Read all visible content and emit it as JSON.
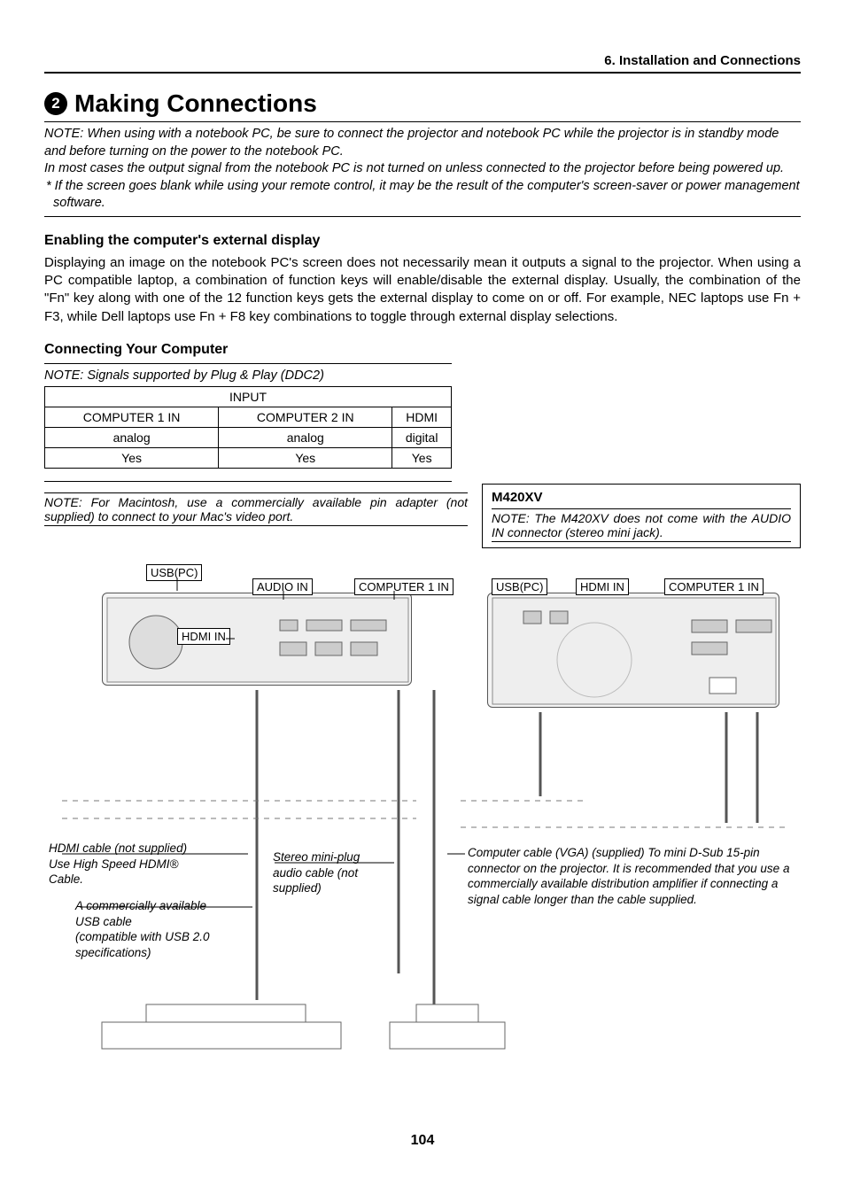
{
  "section_header": "6. Installation and Connections",
  "circle_num": "2",
  "main_title": "Making Connections",
  "note1_lines": [
    "NOTE: When using with a notebook PC, be sure to connect the projector and notebook PC while the projector is in standby mode and before turning on the power to the notebook PC.",
    "In most cases the output signal from the notebook PC is not turned on unless connected to the projector before being powered up.",
    "* If the screen goes blank while using your remote control, it may be the result of the computer's screen-saver or power management software."
  ],
  "sub1": "Enabling the computer's external display",
  "body1": "Displaying an image on the notebook PC's screen does not necessarily mean it outputs a signal to the projector. When using a PC compatible laptop, a combination of function keys will enable/disable the external display. Usually, the combination of the \"Fn\" key along with one of the 12 function keys gets the external display to come on or off. For example, NEC laptops use Fn + F3, while Dell laptops use Fn + F8 key combinations to toggle through external display selections.",
  "sub2": "Connecting Your Computer",
  "ddc_note": "NOTE: Signals supported by Plug & Play (DDC2)",
  "table": {
    "header_span": "INPUT",
    "r1": [
      "COMPUTER 1 IN",
      "COMPUTER 2 IN",
      "HDMI"
    ],
    "r2": [
      "analog",
      "analog",
      "digital"
    ],
    "r3": [
      "Yes",
      "Yes",
      "Yes"
    ]
  },
  "mac_note": "NOTE: For Macintosh, use a commercially available pin adapter (not supplied) to connect to your Mac's video port.",
  "m420": {
    "model": "M420XV",
    "note": "NOTE: The M420XV does not come with the AUDIO IN connector (stereo mini jack)."
  },
  "labels": {
    "usb_pc": "USB(PC)",
    "audio_in": "AUDIO IN",
    "computer1_in": "COMPUTER 1 IN",
    "hdmi_in": "HDMI IN"
  },
  "callouts": {
    "hdmi": "HDMI cable (not supplied)\nUse High Speed HDMI®\nCable.",
    "usb": "A commercially available\nUSB cable\n(compatible with USB 2.0\nspecifications)",
    "stereo": "Stereo mini-plug\naudio cable (not\nsupplied)",
    "vga": "Computer cable (VGA) (supplied)\nTo mini D-Sub 15-pin connector on the projector. It is recommended that you use a commercially available distribution amplifier if connecting a signal cable longer than the cable supplied."
  },
  "page_number": "104"
}
